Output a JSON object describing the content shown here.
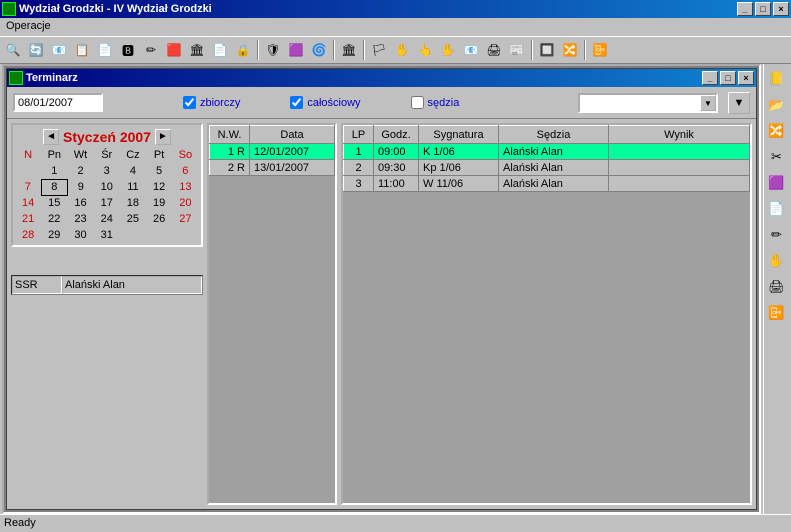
{
  "window": {
    "title": "Wydział Grodzki  -  IV Wydział Grodzki"
  },
  "menu": {
    "operacje": "Operacje"
  },
  "child": {
    "title": "Terminarz"
  },
  "filter": {
    "date": "08/01/2007",
    "zbiorczy": "zbiorczy",
    "calosciowy": "całościowy",
    "sedzia": "sędzia"
  },
  "calendar": {
    "title": "Styczeń 2007",
    "dow": [
      "N",
      "Pn",
      "Wt",
      "Śr",
      "Cz",
      "Pt",
      "So"
    ],
    "rows": [
      [
        "",
        "1",
        "2",
        "3",
        "4",
        "5",
        "6"
      ],
      [
        "7",
        "8",
        "9",
        "10",
        "11",
        "12",
        "13"
      ],
      [
        "14",
        "15",
        "16",
        "17",
        "18",
        "19",
        "20"
      ],
      [
        "21",
        "22",
        "23",
        "24",
        "25",
        "26",
        "27"
      ],
      [
        "28",
        "29",
        "30",
        "31",
        "",
        "",
        ""
      ]
    ],
    "today": "8"
  },
  "ssr": {
    "label": "SSR",
    "value": "Alański Alan"
  },
  "grid1": {
    "headers": {
      "nw": "N.W.",
      "data": "Data"
    },
    "rows": [
      {
        "nw": "1 R",
        "data": "12/01/2007",
        "sel": true
      },
      {
        "nw": "2 R",
        "data": "13/01/2007",
        "sel": false
      }
    ]
  },
  "grid2": {
    "headers": {
      "lp": "LP",
      "godz": "Godz.",
      "syg": "Sygnatura",
      "sedzia": "Sędzia",
      "wynik": "Wynik"
    },
    "rows": [
      {
        "lp": "1",
        "godz": "09:00",
        "syg": "K 1/06",
        "sedzia": "Alański Alan",
        "wynik": "",
        "sel": true
      },
      {
        "lp": "2",
        "godz": "09:30",
        "syg": "Kp 1/06",
        "sedzia": "Alański Alan",
        "wynik": "",
        "sel": false
      },
      {
        "lp": "3",
        "godz": "11:00",
        "syg": "W 11/06",
        "sedzia": "Alański Alan",
        "wynik": "",
        "sel": false
      }
    ]
  },
  "status": {
    "text": "Ready"
  },
  "toolbar_icons": [
    "🔍",
    "🔄",
    "📧",
    "📋",
    "📄",
    "🅱",
    "✏",
    "🟥",
    "🏛",
    "📄",
    "🔒",
    "",
    "🛡",
    "🟪",
    "🌀",
    "",
    "🏛",
    "",
    "🏳",
    "✋",
    "👆",
    "✋",
    "📧",
    "🖨",
    "📰",
    "",
    "🔲",
    "🔀",
    "",
    "📴"
  ],
  "right_icons": [
    "📒",
    "📂",
    "🔀",
    "✂",
    "🟪",
    "📄",
    "✏",
    "✋",
    "🖨",
    "📴"
  ]
}
